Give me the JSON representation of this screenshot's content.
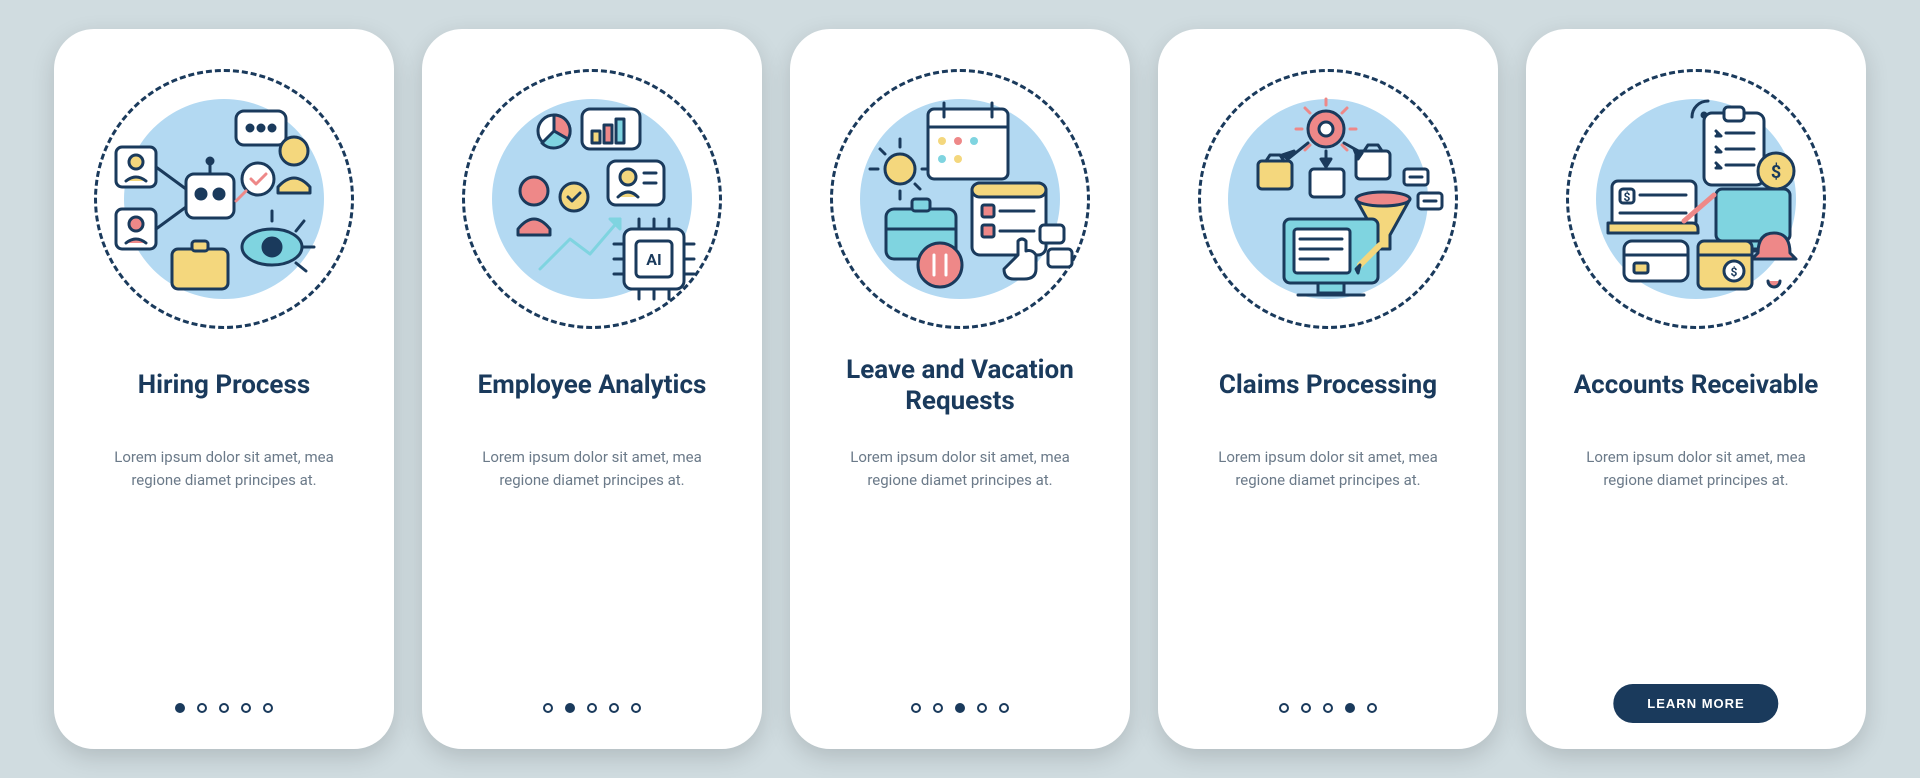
{
  "screens": [
    {
      "title": "Hiring Process",
      "desc": "Lorem ipsum dolor sit amet, mea regione diamet principes at.",
      "icon": "hiring"
    },
    {
      "title": "Employee Analytics",
      "desc": "Lorem ipsum dolor sit amet, mea regione diamet principes at.",
      "icon": "analytics"
    },
    {
      "title": "Leave and Vacation Requests",
      "desc": "Lorem ipsum dolor sit amet, mea regione diamet principes at.",
      "icon": "vacation"
    },
    {
      "title": "Claims Processing",
      "desc": "Lorem ipsum dolor sit amet, mea regione diamet principes at.",
      "icon": "claims"
    },
    {
      "title": "Accounts Receivable",
      "desc": "Lorem ipsum dolor sit amet, mea regione diamet principes at.",
      "icon": "accounts"
    }
  ],
  "cta_label": "LEARN MORE",
  "total_dots": 5
}
